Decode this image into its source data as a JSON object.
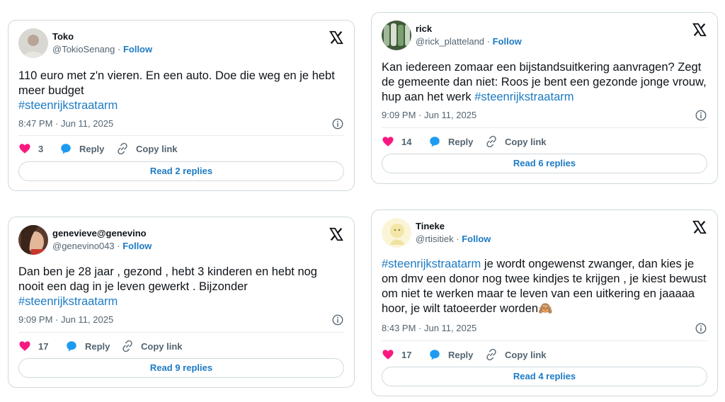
{
  "tweets": [
    {
      "name": "Toko",
      "handle": "@TokioSenang",
      "follow": "Follow",
      "text_before": "110 euro met z'n vieren. En een auto. Doe die weg en je hebt meer budget",
      "hashtag": "#steenrijkstraatarm",
      "text_after": "",
      "timestamp": "8:47 PM · Jun 11, 2025",
      "likes": "3",
      "reply_label": "Reply",
      "copy_label": "Copy link",
      "read_replies": "Read 2 replies"
    },
    {
      "name": "rick",
      "handle": "@rick_platteland",
      "follow": "Follow",
      "text_before": "Kan iedereen zomaar een bijstandsuitkering aanvragen? Zegt de gemeente dan niet: Roos je bent een gezonde jonge vrouw, hup aan het werk",
      "hashtag": "#steenrijkstraatarm",
      "text_after": "",
      "timestamp": "9:09 PM · Jun 11, 2025",
      "likes": "14",
      "reply_label": "Reply",
      "copy_label": "Copy link",
      "read_replies": "Read 6 replies"
    },
    {
      "name": "genevieve@genevino",
      "handle": "@genevino043",
      "follow": "Follow",
      "text_before": "Dan ben je 28 jaar , gezond , hebt 3 kinderen en hebt nog nooit een dag in je leven gewerkt . Bijzonder",
      "hashtag": "#steenrijkstraatarm",
      "text_after": "",
      "timestamp": "9:09 PM · Jun 11, 2025",
      "likes": "17",
      "reply_label": "Reply",
      "copy_label": "Copy link",
      "read_replies": "Read 9 replies"
    },
    {
      "name": "Tineke",
      "handle": "@rtisitiek",
      "follow": "Follow",
      "text_before": "",
      "hashtag": "#steenrijkstraatarm",
      "text_after": " je wordt ongewenst zwanger, dan kies je om dmv een donor nog twee kindjes te krijgen , je kiest bewust om niet te werken maar te leven van een uitkering en jaaaaa hoor, je wilt tatoeerder worden🙈",
      "timestamp": "8:43 PM · Jun 11, 2025",
      "likes": "17",
      "reply_label": "Reply",
      "copy_label": "Copy link",
      "read_replies": "Read 4 replies"
    }
  ],
  "icons": {
    "x_logo": "x-logo-icon",
    "info": "info-icon",
    "like": "heart-icon",
    "reply": "speech-bubble-icon",
    "copy": "link-icon"
  },
  "colors": {
    "accent": "#1d7bc4",
    "like": "#f91880",
    "text": "#0f1419",
    "muted": "#536471",
    "border": "#cfd9de"
  }
}
